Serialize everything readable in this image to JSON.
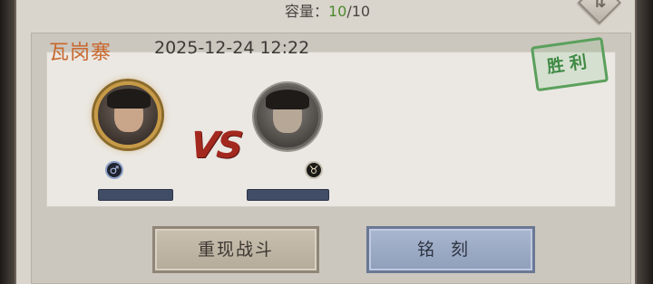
{
  "header": {
    "capacity_label": "容量：",
    "capacity_current": "10",
    "capacity_max": "/10",
    "sort_icon": "swap-arrows-icon"
  },
  "record": {
    "location": "瓦岗寨",
    "datetime": "2025-12-24 12:22",
    "result": "胜利",
    "vs_text": "VS",
    "player_badge_icon": "male-symbol-icon",
    "opponent_badge_icon": "ox-head-icon"
  },
  "actions": {
    "replay_label": "重现战斗",
    "engrave_label": "铭刻"
  },
  "colors": {
    "location": "#c8682e",
    "capacity_current": "#4d8a2c",
    "result_stamp": "#3f8a45",
    "vs": "#a3291f",
    "engrave_button": "#8f9eba"
  }
}
